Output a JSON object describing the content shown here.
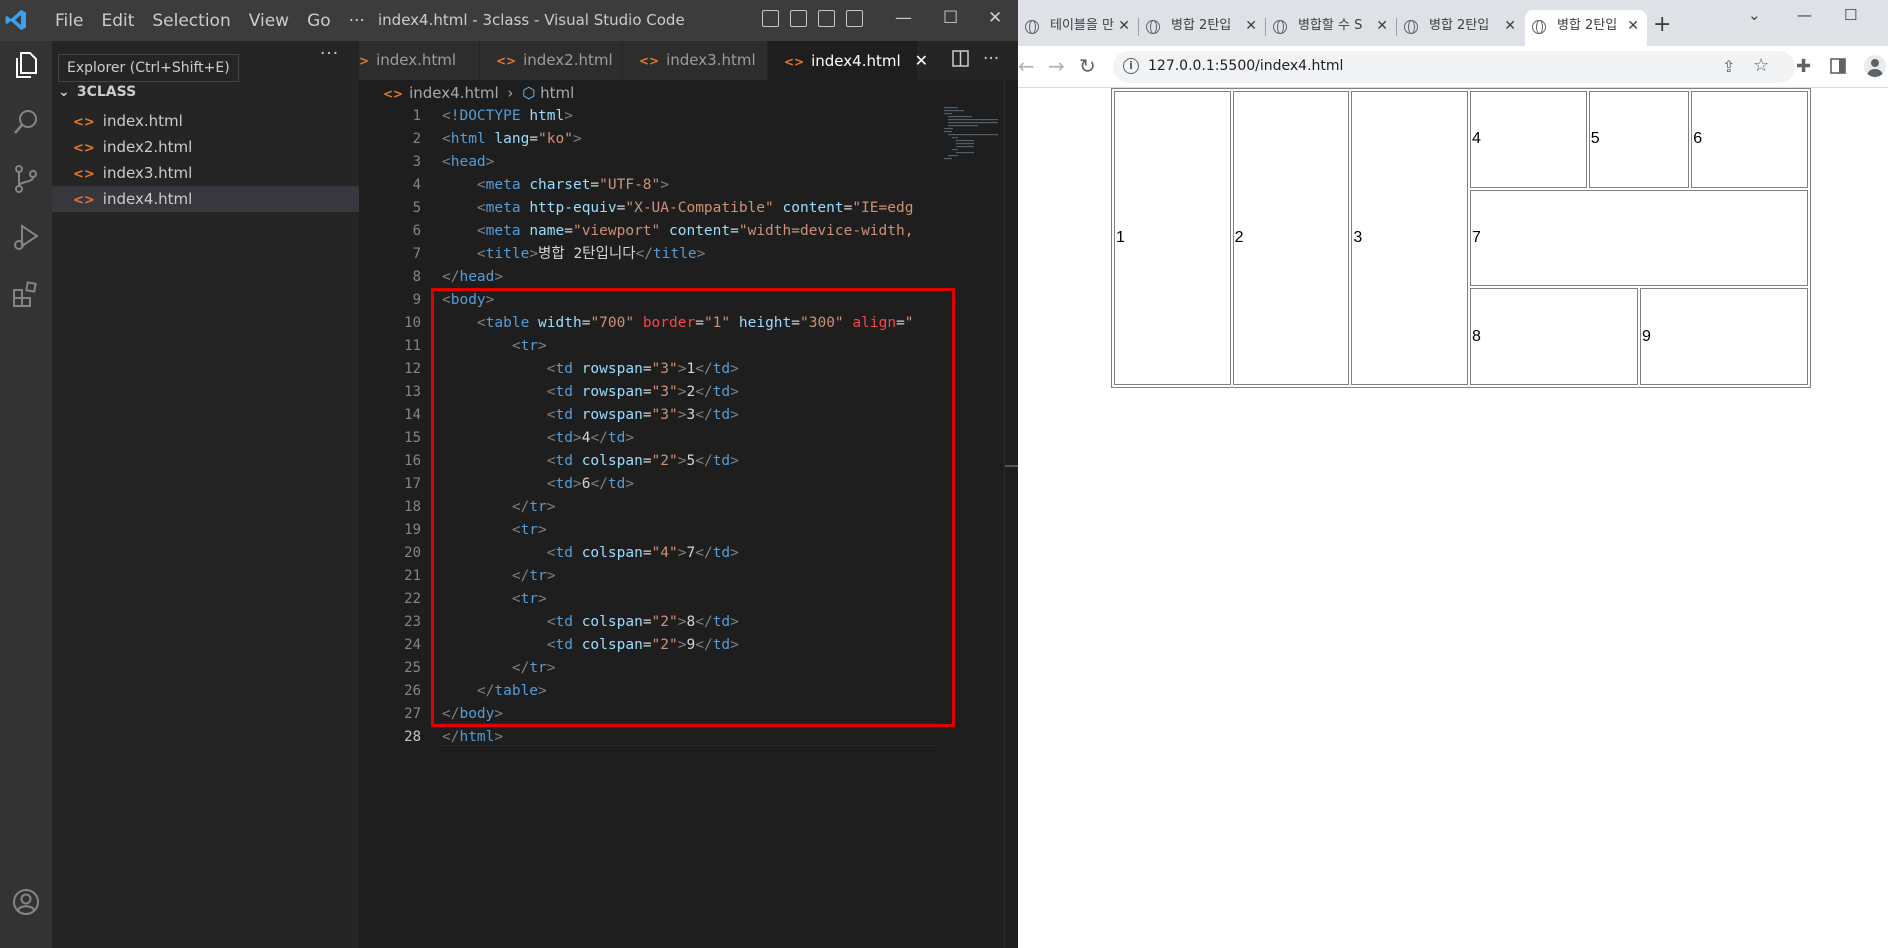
{
  "vscode": {
    "menu": [
      "File",
      "Edit",
      "Selection",
      "View",
      "Go",
      "···"
    ],
    "window_title": "index4.html - 3class - Visual Studio Code",
    "window_controls": {
      "minimize": "—",
      "maximize": "☐",
      "close": "✕"
    },
    "tooltip": "Explorer (Ctrl+Shift+E)",
    "sidebar_more": "···",
    "folder_name": "3CLASS",
    "files": [
      "index.html",
      "index2.html",
      "index3.html",
      "index4.html"
    ],
    "tabs": [
      "index.html",
      "index2.html",
      "index3.html",
      "index4.html"
    ],
    "active_tab_close": "✕",
    "tab_actions": "···",
    "breadcrumb": {
      "file": "index4.html",
      "separator": "›",
      "node": "html"
    },
    "line_numbers": [
      "1",
      "2",
      "3",
      "4",
      "5",
      "6",
      "7",
      "8",
      "9",
      "10",
      "11",
      "12",
      "13",
      "14",
      "15",
      "16",
      "17",
      "18",
      "19",
      "20",
      "21",
      "22",
      "23",
      "24",
      "25",
      "26",
      "27",
      "28"
    ],
    "code_lines": [
      "<!DOCTYPE html>",
      "<html lang=\"ko\">",
      "<head>",
      "    <meta charset=\"UTF-8\">",
      "    <meta http-equiv=\"X-UA-Compatible\" content=\"IE=edg",
      "    <meta name=\"viewport\" content=\"width=device-width,",
      "    <title>병합 2탄입니다</title>",
      "</head>",
      "<body>",
      "    <table width=\"700\" border=\"1\" height=\"300\" align=\"",
      "        <tr>",
      "            <td rowspan=\"3\">1</td>",
      "            <td rowspan=\"3\">2</td>",
      "            <td rowspan=\"3\">3</td>",
      "            <td>4</td>",
      "            <td colspan=\"2\">5</td>",
      "            <td>6</td>",
      "        </tr>",
      "        <tr>",
      "            <td colspan=\"4\">7</td>",
      "        </tr>",
      "        <tr>",
      "            <td colspan=\"2\">8</td>",
      "            <td colspan=\"2\">9</td>",
      "        </tr>",
      "    </table>",
      "</body>",
      "</html>"
    ],
    "highlight_color": "#e00000"
  },
  "chrome": {
    "tabs": [
      "테이블을 만",
      "병합 2탄입",
      "병합할 수 S",
      "병합 2탄입",
      "병합 2탄입"
    ],
    "tab_close": "✕",
    "new_tab": "+",
    "window_controls": {
      "chevron": "⌄",
      "minimize": "—",
      "maximize": "☐"
    },
    "url": "127.0.0.1:5500/index4.html",
    "rendered_table_cells": [
      "1",
      "2",
      "3",
      "4",
      "5",
      "6",
      "7",
      "8",
      "9"
    ]
  }
}
